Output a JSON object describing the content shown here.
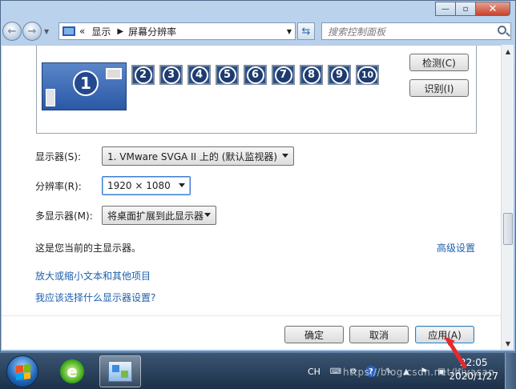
{
  "window": {
    "controls": {
      "minimize": "—",
      "maximize": "▫",
      "close": "✕"
    }
  },
  "navbar": {
    "back_icon": "back-arrow-icon",
    "forward_icon": "forward-arrow-icon",
    "breadcrumb_prefix": "«",
    "breadcrumb": [
      "显示",
      "屏幕分辨率"
    ],
    "search_placeholder": "搜索控制面板"
  },
  "preview": {
    "primary_monitor": "1",
    "other_monitors": [
      "2",
      "3",
      "4",
      "5",
      "6",
      "7",
      "8",
      "9",
      "10"
    ],
    "detect_label": "检测(C)",
    "identify_label": "识别(I)"
  },
  "settings": {
    "display_label": "显示器(S):",
    "display_value": "1. VMware SVGA II 上的 (默认监视器)",
    "resolution_label": "分辨率(R):",
    "resolution_value": "1920 × 1080",
    "multi_label": "多显示器(M):",
    "multi_value": "将桌面扩展到此显示器"
  },
  "info": {
    "primary_text": "这是您当前的主显示器。",
    "advanced_link": "高级设置",
    "link_text_size": "放大或缩小文本和其他项目",
    "link_which_settings": "我应该选择什么显示器设置?"
  },
  "footer": {
    "ok_label": "确定",
    "cancel_label": "取消",
    "apply_label": "应用(A)"
  },
  "taskbar": {
    "language": "CH",
    "time": "22:05",
    "date": "2020/1/27"
  },
  "watermark": "https://blog.csdn.net/hiyasan",
  "colors": {
    "link": "#1e5fab",
    "annotation_arrow": "#e8282a",
    "taskbar": "#1d3148"
  }
}
